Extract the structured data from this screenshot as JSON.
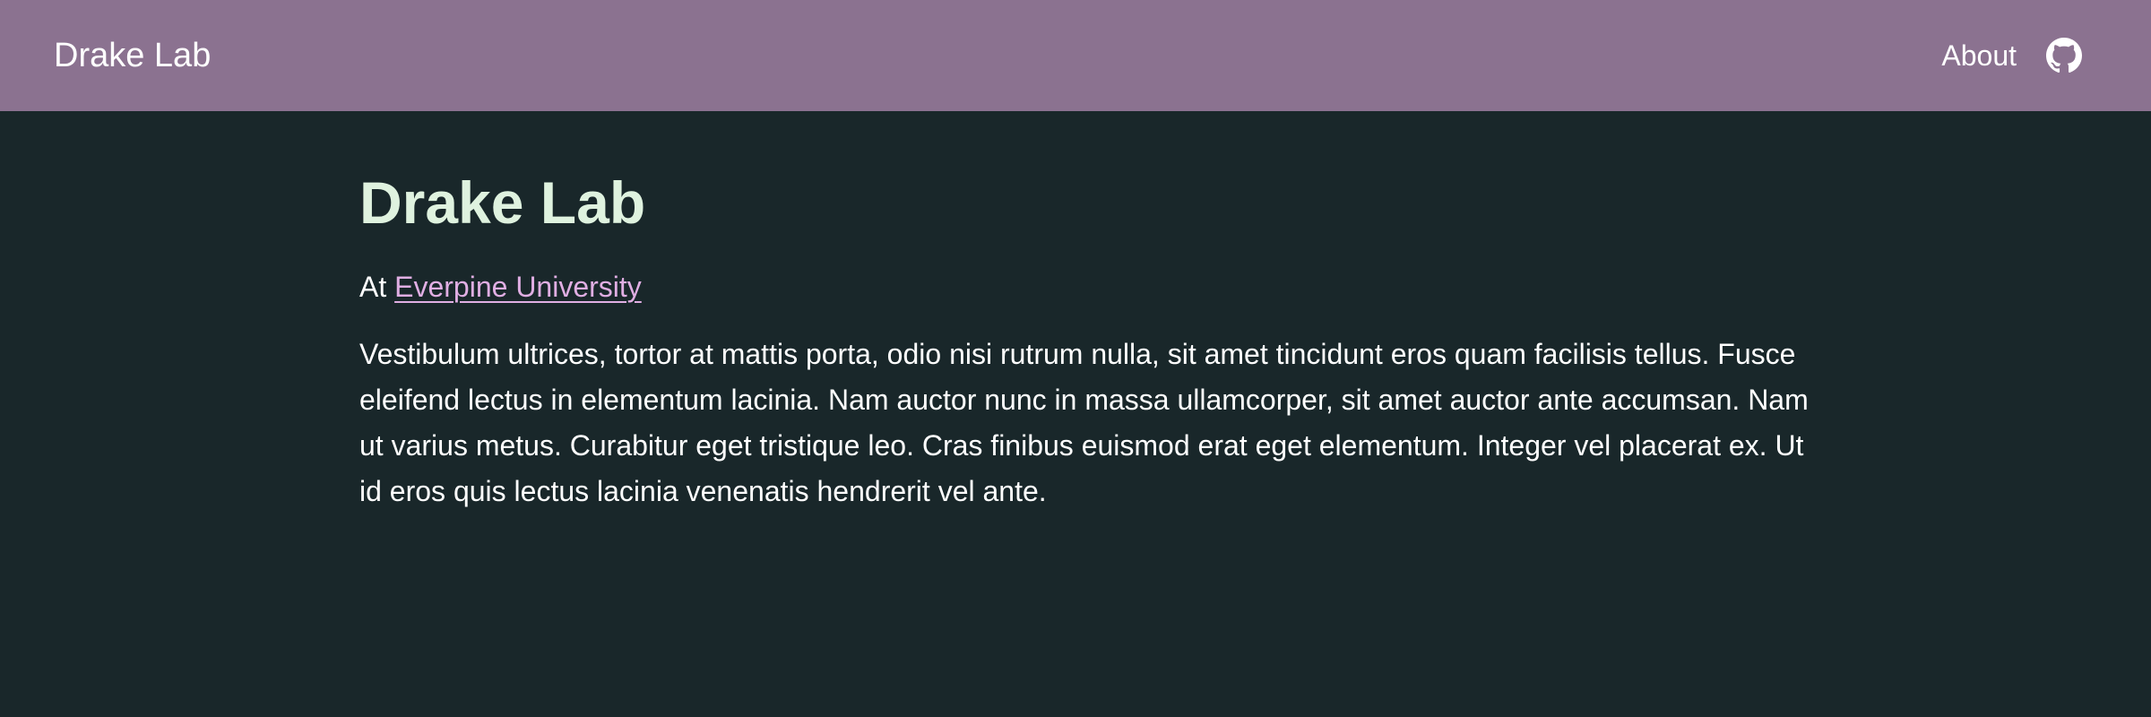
{
  "header": {
    "brand": "Drake Lab",
    "nav": {
      "about_label": "About",
      "github_icon": "github-icon"
    },
    "background_color": "#8b7290"
  },
  "main": {
    "title": "Drake Lab",
    "affiliation": {
      "prefix": "At",
      "institution_link_text": "Everpine University"
    },
    "description": "Vestibulum ultrices, tortor at mattis porta, odio nisi rutrum nulla, sit amet tincidunt eros quam facilisis tellus. Fusce eleifend lectus in elementum lacinia. Nam auctor nunc in massa ullamcorper, sit amet auctor ante accumsan. Nam ut varius metus. Curabitur eget tristique leo. Cras finibus euismod erat eget elementum. Integer vel placerat ex. Ut id eros quis lectus lacinia venenatis hendrerit vel ante."
  },
  "colors": {
    "page_background": "#19272a",
    "title_text": "#dff2df",
    "body_text": "#ffffff",
    "link_text": "#e0aee3"
  }
}
